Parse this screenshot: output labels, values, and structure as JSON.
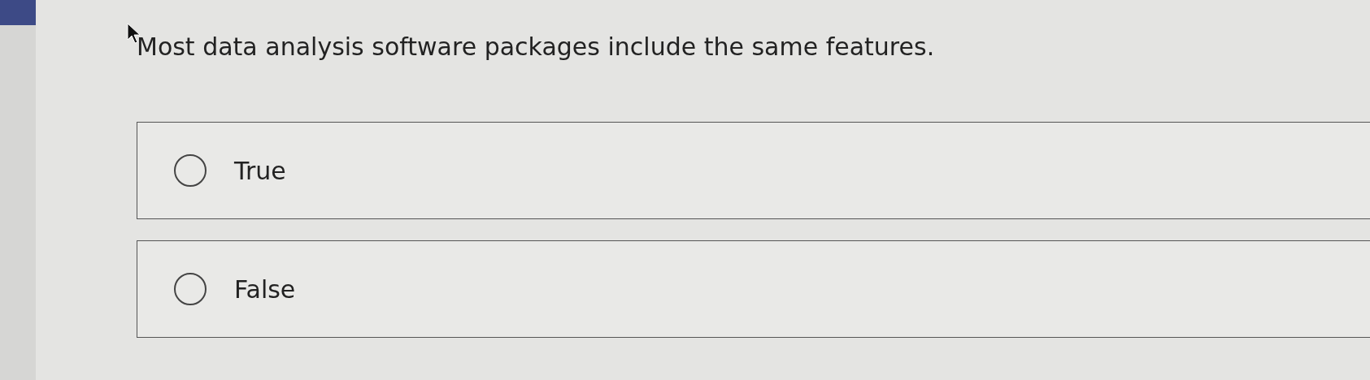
{
  "question": "Most data analysis software packages include the same features.",
  "options": [
    {
      "label": "True",
      "selected": false
    },
    {
      "label": "False",
      "selected": false
    }
  ]
}
